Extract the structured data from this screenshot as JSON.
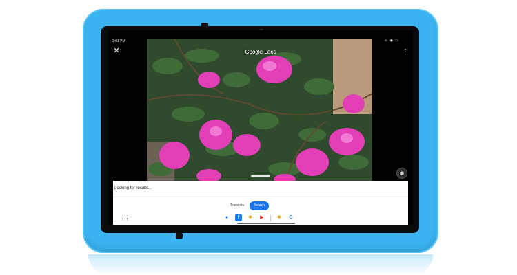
{
  "status_bar": {
    "time": "3:01 PM",
    "right_icons": "⚠ ◉ ▭"
  },
  "header": {
    "title": "Google Lens",
    "close_icon": "close-icon",
    "menu_icon": "more-vert-icon"
  },
  "results_sheet": {
    "status_text": "Looking for results...",
    "modes": [
      {
        "label": "Translate",
        "selected": false
      },
      {
        "label": "Search",
        "selected": true
      }
    ]
  },
  "taskbar": {
    "apps": [
      "messages-icon",
      "facebook-icon",
      "google-photos-icon",
      "youtube-icon",
      "google-photos-icon",
      "google-icon"
    ]
  },
  "colors": {
    "case": "#3ab4f0",
    "accent": "#1a73e8",
    "screen_bg": "#000000"
  }
}
